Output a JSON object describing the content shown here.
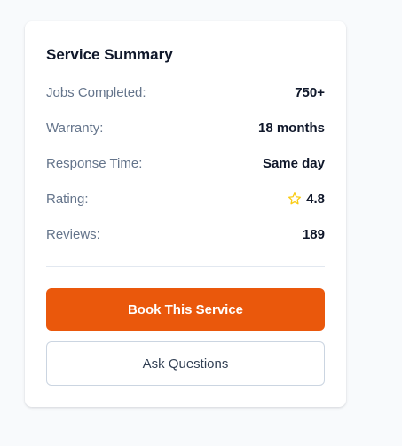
{
  "summary": {
    "title": "Service Summary",
    "rows": [
      {
        "label": "Jobs Completed:",
        "value": "750+"
      },
      {
        "label": "Warranty:",
        "value": "18 months"
      },
      {
        "label": "Response Time:",
        "value": "Same day"
      },
      {
        "label": "Rating:",
        "value": "4.8",
        "icon": "star-outline-icon"
      },
      {
        "label": "Reviews:",
        "value": "189"
      }
    ]
  },
  "actions": {
    "book_label": "Book This Service",
    "ask_label": "Ask Questions"
  },
  "colors": {
    "accent": "#ea580c",
    "star": "#facc15"
  }
}
